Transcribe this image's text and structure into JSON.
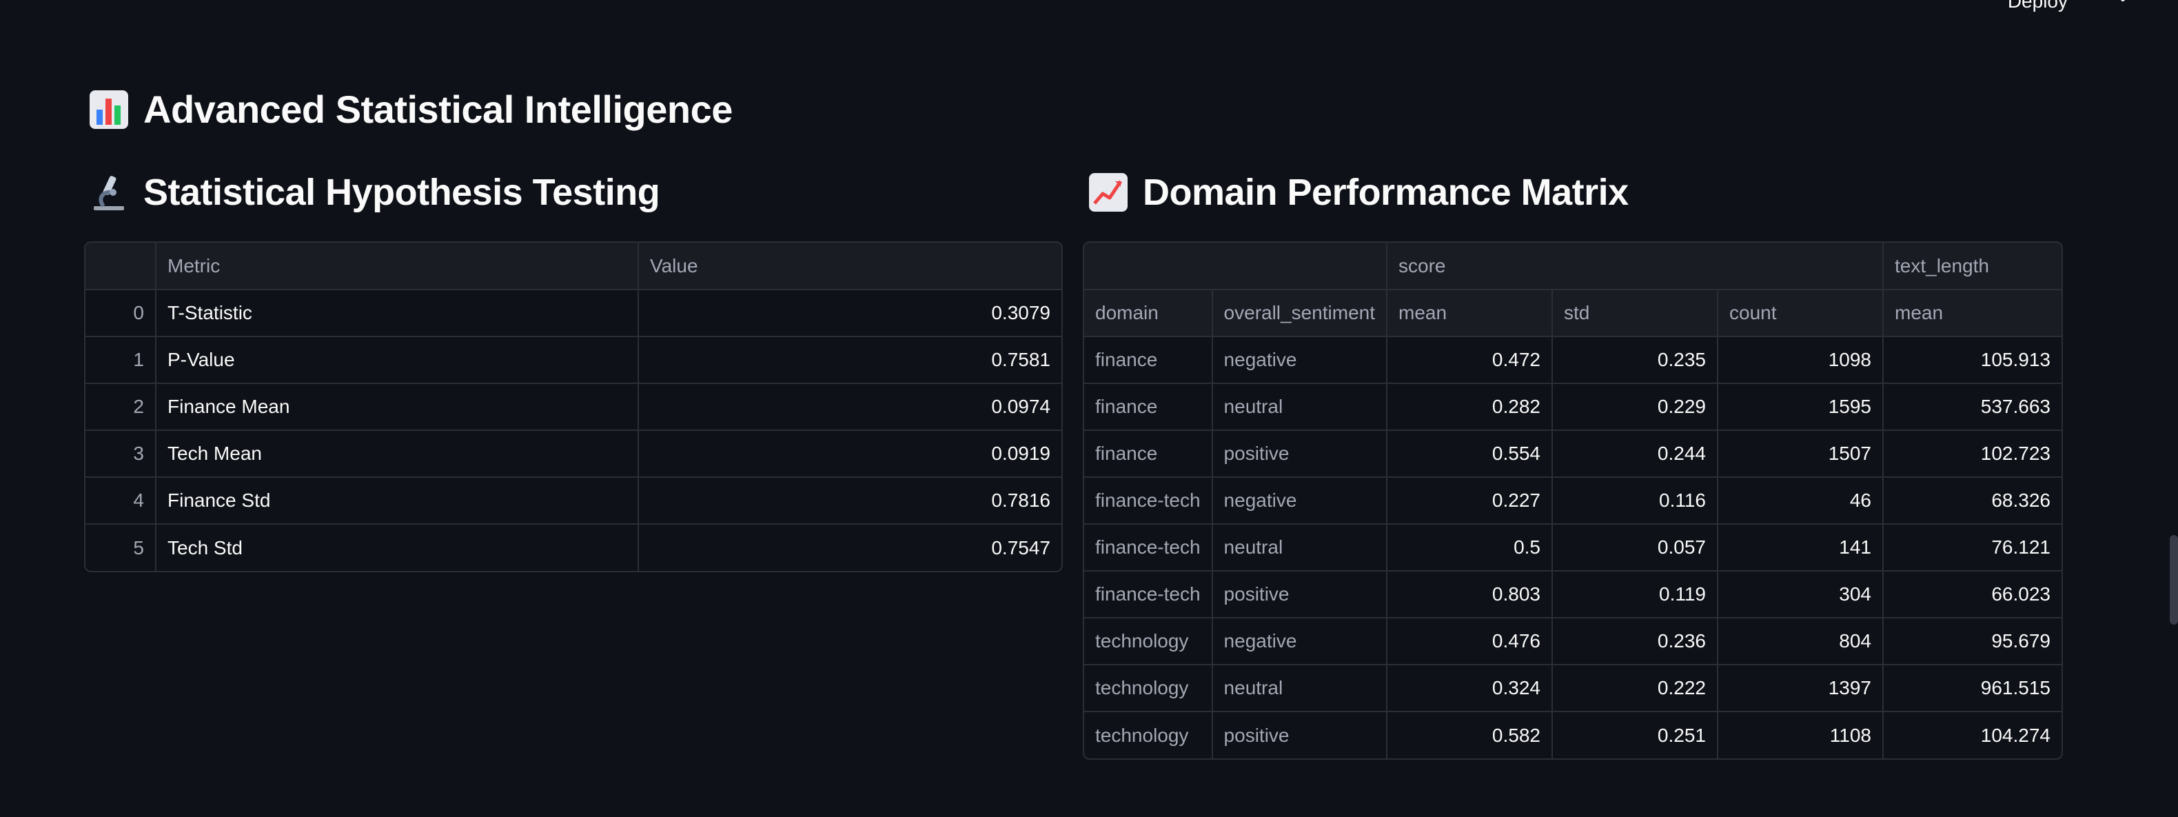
{
  "toolbar": {
    "deploy_label": "Deploy"
  },
  "main_title": "Advanced Statistical Intelligence",
  "left_section": {
    "title": "Statistical Hypothesis Testing",
    "columns": [
      "",
      "Metric",
      "Value"
    ],
    "rows": [
      {
        "index": "0",
        "metric": "T-Statistic",
        "value": "0.3079"
      },
      {
        "index": "1",
        "metric": "P-Value",
        "value": "0.7581"
      },
      {
        "index": "2",
        "metric": "Finance Mean",
        "value": "0.0974"
      },
      {
        "index": "3",
        "metric": "Tech Mean",
        "value": "0.0919"
      },
      {
        "index": "4",
        "metric": "Finance Std",
        "value": "0.7816"
      },
      {
        "index": "5",
        "metric": "Tech Std",
        "value": "0.7547"
      }
    ]
  },
  "right_section": {
    "title": "Domain Performance Matrix",
    "header_top": [
      "",
      "score",
      "text_length"
    ],
    "header_bottom": [
      "domain",
      "overall_sentiment",
      "mean",
      "std",
      "count",
      "mean"
    ],
    "rows": [
      {
        "domain": "finance",
        "sentiment": "negative",
        "mean": "0.472",
        "std": "0.235",
        "count": "1098",
        "text_mean": "105.913"
      },
      {
        "domain": "finance",
        "sentiment": "neutral",
        "mean": "0.282",
        "std": "0.229",
        "count": "1595",
        "text_mean": "537.663"
      },
      {
        "domain": "finance",
        "sentiment": "positive",
        "mean": "0.554",
        "std": "0.244",
        "count": "1507",
        "text_mean": "102.723"
      },
      {
        "domain": "finance-tech",
        "sentiment": "negative",
        "mean": "0.227",
        "std": "0.116",
        "count": "46",
        "text_mean": "68.326"
      },
      {
        "domain": "finance-tech",
        "sentiment": "neutral",
        "mean": "0.5",
        "std": "0.057",
        "count": "141",
        "text_mean": "76.121"
      },
      {
        "domain": "finance-tech",
        "sentiment": "positive",
        "mean": "0.803",
        "std": "0.119",
        "count": "304",
        "text_mean": "66.023"
      },
      {
        "domain": "technology",
        "sentiment": "negative",
        "mean": "0.476",
        "std": "0.236",
        "count": "804",
        "text_mean": "95.679"
      },
      {
        "domain": "technology",
        "sentiment": "neutral",
        "mean": "0.324",
        "std": "0.222",
        "count": "1397",
        "text_mean": "961.515"
      },
      {
        "domain": "technology",
        "sentiment": "positive",
        "mean": "0.582",
        "std": "0.251",
        "count": "1108",
        "text_mean": "104.274"
      }
    ]
  },
  "icons": {
    "main_title_icon": "bar-chart-icon",
    "left_title_icon": "microscope-icon",
    "right_title_icon": "chart-increasing-icon",
    "menu_icon": "kebab-menu-icon"
  },
  "colors": {
    "background": "#0e1117",
    "border": "#2b2e36",
    "muted_text": "#a3a8b4"
  }
}
